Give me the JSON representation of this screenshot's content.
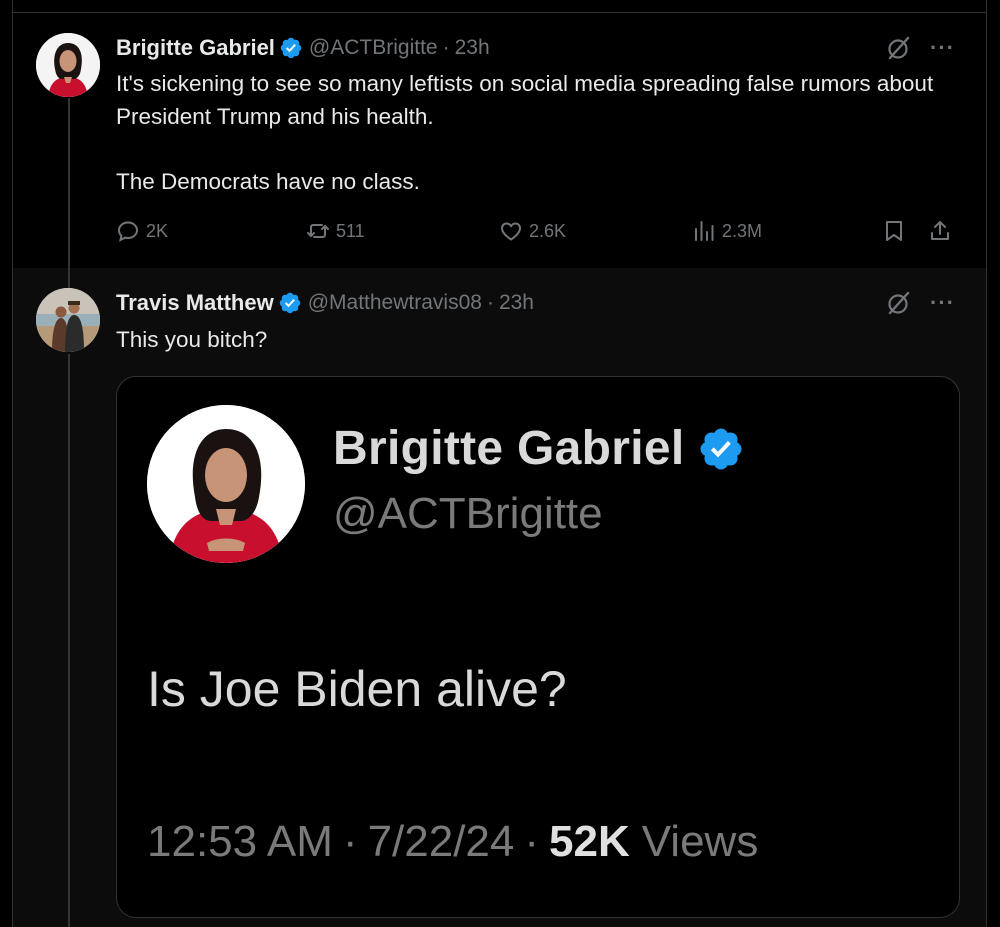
{
  "colors": {
    "background": "#000000",
    "reply_background": "#0c0c0c",
    "text_primary": "#e7e9ea",
    "text_secondary": "#71767b",
    "verified_blue": "#1d9bf0",
    "border": "#2f3336"
  },
  "tweet": {
    "author": {
      "display_name": "Brigitte Gabriel",
      "handle": "@ACTBrigitte",
      "verified": true,
      "avatar_icon": "avatar-woman-red-dress"
    },
    "time": "23h",
    "text": "It's sickening to see so many leftists on social media spreading false rumors about President Trump and his health.\n\nThe Democrats have no class.",
    "actions": {
      "replies": "2K",
      "reposts": "511",
      "likes": "2.6K",
      "views": "2.3M"
    },
    "icons": [
      "reply-icon",
      "repost-icon",
      "like-icon",
      "views-icon",
      "bookmark-icon",
      "share-icon",
      "grok-icon",
      "more-icon"
    ]
  },
  "reply": {
    "author": {
      "display_name": "Travis Matthew",
      "handle": "@Matthewtravis08",
      "verified": true,
      "avatar_icon": "avatar-couple-beach"
    },
    "time": "23h",
    "text": "This you bitch?",
    "embedded_screenshot": {
      "display_name": "Brigitte Gabriel",
      "handle": "@ACTBrigitte",
      "verified": true,
      "text": "Is Joe Biden alive?",
      "time": "12:53 AM",
      "date": "7/22/24",
      "views_count": "52K",
      "views_label": "Views"
    }
  }
}
